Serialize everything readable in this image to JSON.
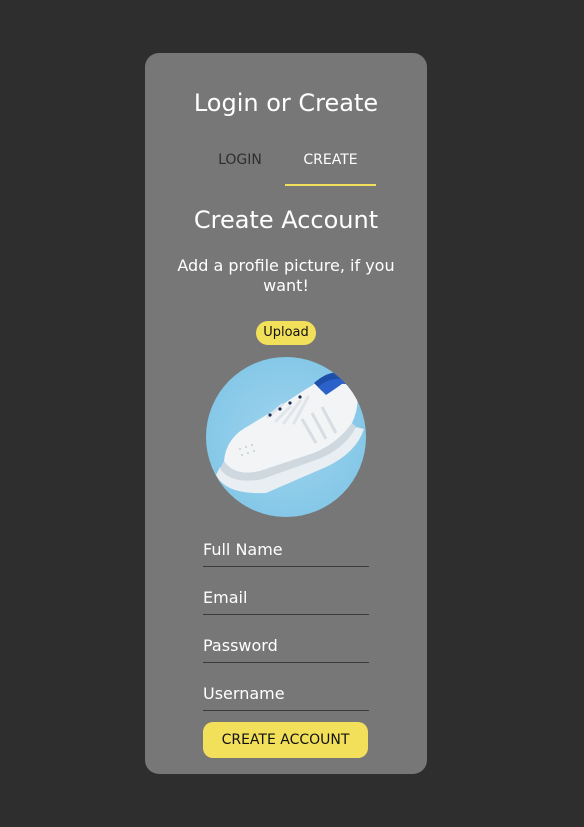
{
  "colors": {
    "background": "#2e2e2e",
    "card": "#777777",
    "accent": "#f3e05a",
    "text": "#ffffff"
  },
  "card": {
    "title": "Login or Create",
    "tabs": [
      {
        "label": "LOGIN",
        "active": false
      },
      {
        "label": "CREATE",
        "active": true
      }
    ]
  },
  "create": {
    "heading": "Create Account",
    "subtitle": "Add a profile picture, if you want!",
    "upload_label": "Upload",
    "avatar_icon": "sneaker-photo",
    "fields": [
      {
        "name": "full-name",
        "placeholder": "Full Name"
      },
      {
        "name": "email",
        "placeholder": "Email"
      },
      {
        "name": "password",
        "placeholder": "Password"
      },
      {
        "name": "username",
        "placeholder": "Username"
      }
    ],
    "submit_label": "CREATE ACCOUNT"
  }
}
